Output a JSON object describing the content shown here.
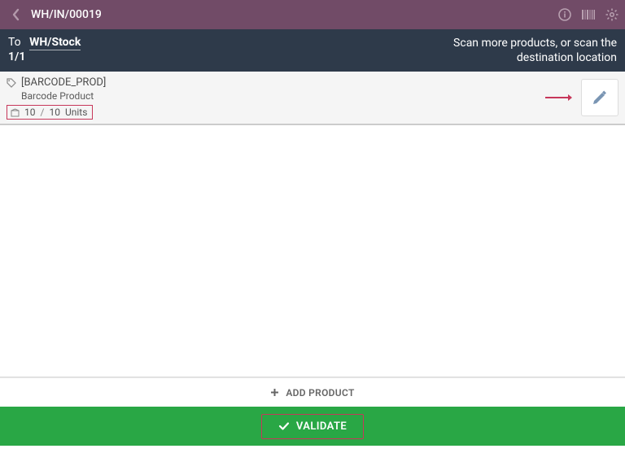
{
  "topbar": {
    "title": "WH/IN/00019"
  },
  "subbar": {
    "to_label": "To",
    "destination": "WH/Stock",
    "counter": "1/1",
    "hint_line1": "Scan more products, or scan the",
    "hint_line2": "destination location"
  },
  "product": {
    "code": "[BARCODE_PROD]",
    "name": "Barcode Product",
    "qty_done": "10",
    "qty_sep": "/",
    "qty_expected": "10",
    "uom": "Units"
  },
  "buttons": {
    "add_product": "ADD PRODUCT",
    "validate": "VALIDATE"
  }
}
